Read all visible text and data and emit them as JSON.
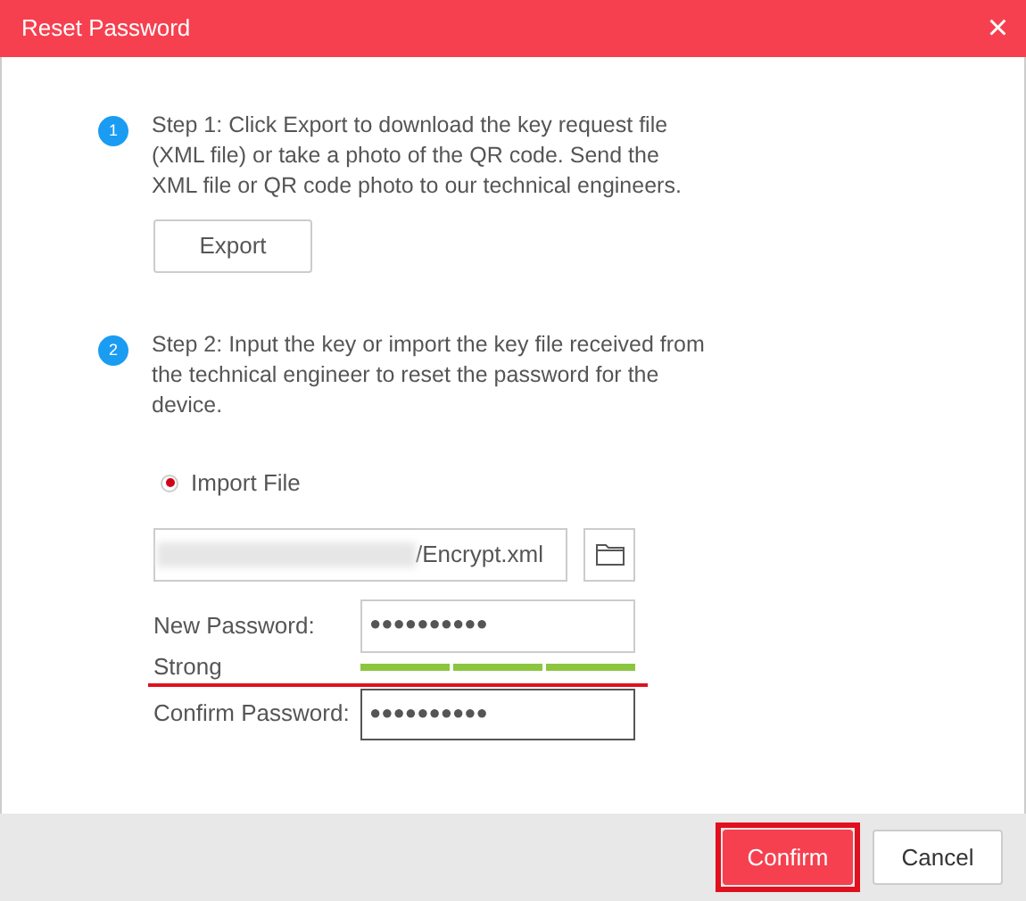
{
  "window": {
    "title": "Reset Password",
    "close": "×"
  },
  "steps": [
    {
      "number": "1",
      "text": "Step 1: Click Export to download the key request file (XML file) or take a photo of the QR code. Send the XML file or QR code photo to our technical engineers."
    },
    {
      "number": "2",
      "text": "Step 2: Input the key or import the key file received from the technical engineer to reset the password for the device."
    }
  ],
  "export_button": "Export",
  "import_option": {
    "label": "Import File",
    "selected": true
  },
  "file_field": {
    "value": "/Encrypt.xml",
    "blurred_prefix": true
  },
  "new_password": {
    "label": "New Password:",
    "value": "●●●●●●●●●●"
  },
  "strength": {
    "label": "Strong",
    "level": 1,
    "underlined": true
  },
  "confirm_password": {
    "label": "Confirm Password:",
    "value": "●●●●●●●●●●"
  },
  "buttons": [
    {
      "label": "Confirm",
      "kind": "primary",
      "highlighted": true
    },
    {
      "label": "Cancel",
      "kind": "secondary",
      "highlighted": false
    }
  ]
}
